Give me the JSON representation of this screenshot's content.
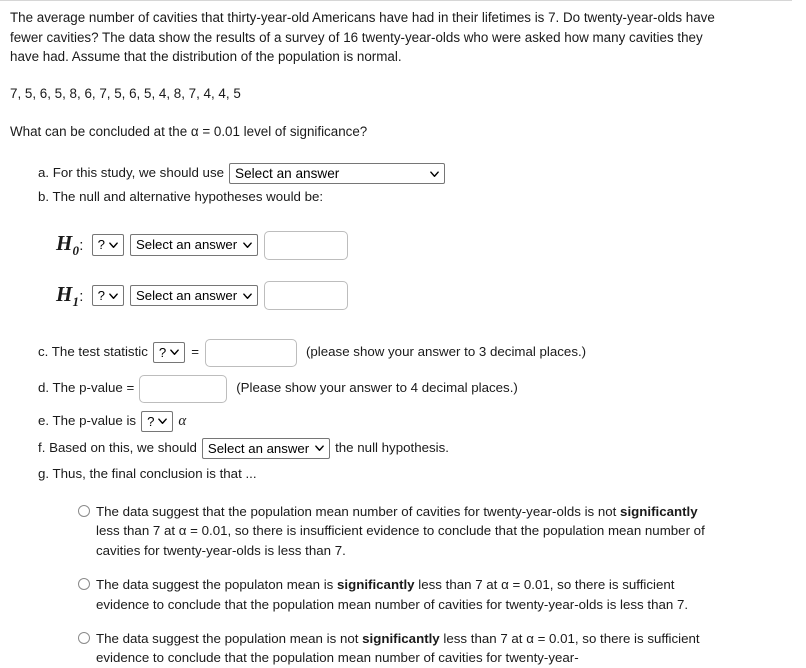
{
  "problem": {
    "intro": "The average number of cavities that thirty-year-old Americans have had in their lifetimes is 7.  Do twenty-year-olds have fewer cavities? The data show the results of a survey of 16 twenty-year-olds who were asked how many cavities they have had. Assume that the distribution of the population is normal.",
    "data_values": "7, 5, 6, 5, 8, 6, 7, 5, 6, 5, 4, 8, 7, 4, 4, 5",
    "alpha_question": "What can be concluded at the α = 0.01 level of significance?"
  },
  "items": {
    "a": {
      "label": "a. For this study, we should use",
      "select_value": "Select an answer"
    },
    "b": {
      "label": "b. The null and alternative hypotheses would be:"
    },
    "h0": {
      "symbol": "H",
      "subscript": "0",
      "colon": ":",
      "operator_select": "?",
      "answer_select": "Select an answer",
      "value": ""
    },
    "h1": {
      "symbol": "H",
      "subscript": "1",
      "colon": ":",
      "operator_select": "?",
      "answer_select": "Select an answer",
      "value": ""
    },
    "c": {
      "label": "c. The test statistic",
      "stat_select": "?",
      "equals": "=",
      "value": "",
      "note": "(please show your answer to 3 decimal places.)"
    },
    "d": {
      "label": "d. The p-value =",
      "value": "",
      "note": "(Please show your answer to 4 decimal places.)"
    },
    "e": {
      "label": "e. The p-value is",
      "compare_select": "?",
      "alpha": "α"
    },
    "f": {
      "label_before": "f. Based on this, we should",
      "decision_select": "Select an answer",
      "label_after": "the null hypothesis."
    },
    "g": {
      "label": "g. Thus, the final conclusion is that ..."
    }
  },
  "choices": [
    {
      "part1": "The data suggest that the population mean number of cavities for twenty-year-olds is not ",
      "bold": "significantly",
      "part2": " less than 7 at α = 0.01, so there is insufficient evidence to conclude that the population mean number of cavities for twenty-year-olds is less than 7.",
      "selected": false
    },
    {
      "part1": "The data suggest the populaton mean is ",
      "bold": "significantly",
      "part2": " less than 7 at α = 0.01, so there is sufficient evidence to conclude that the population mean number of cavities for twenty-year-olds is less than 7.",
      "selected": false
    },
    {
      "part1": "The data suggest the population mean is not ",
      "bold": "significantly",
      "part2": " less than 7 at α = 0.01, so there is sufficient evidence to conclude that the population mean number of cavities for twenty-year-",
      "selected": false
    }
  ]
}
